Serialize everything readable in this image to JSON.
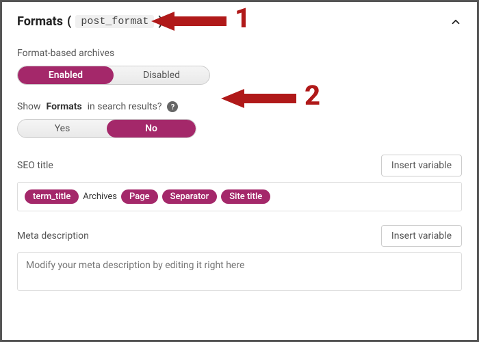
{
  "header": {
    "title_prefix": "Formats",
    "code_name": "post_format",
    "paren_open": "(",
    "paren_close": ")"
  },
  "archives": {
    "label": "Format-based archives",
    "enabled": "Enabled",
    "disabled": "Disabled"
  },
  "search": {
    "prefix": "Show",
    "bold": "Formats",
    "suffix": "in search results?",
    "yes": "Yes",
    "no": "No"
  },
  "seo": {
    "label": "SEO title",
    "insert": "Insert variable",
    "tokens": {
      "term_title": "term_title",
      "archives": "Archives",
      "page": "Page",
      "separator": "Separator",
      "site_title": "Site title"
    }
  },
  "meta": {
    "label": "Meta description",
    "insert": "Insert variable",
    "placeholder": "Modify your meta description by editing it right here"
  },
  "annotations": {
    "one": "1",
    "two": "2"
  },
  "colors": {
    "accent": "#a4286a",
    "annotation": "#b01919"
  }
}
